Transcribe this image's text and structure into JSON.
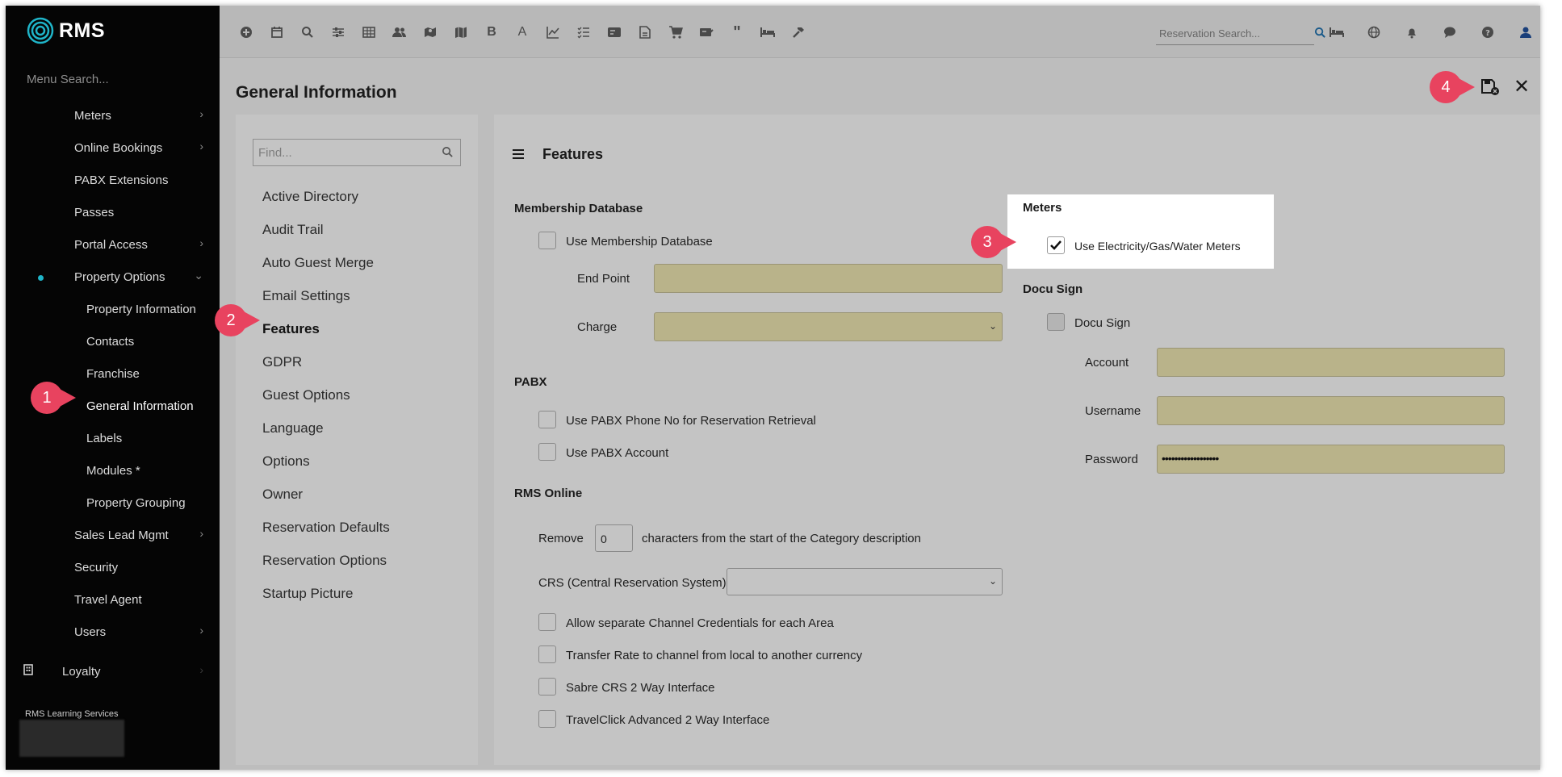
{
  "app": {
    "name": "RMS"
  },
  "sidebar": {
    "search_placeholder": "Menu Search...",
    "items": [
      {
        "label": "Meters",
        "has_chevron": true
      },
      {
        "label": "Online Bookings",
        "has_chevron": true
      },
      {
        "label": "PABX Extensions",
        "has_chevron": false
      },
      {
        "label": "Passes",
        "has_chevron": false
      },
      {
        "label": "Portal Access",
        "has_chevron": true
      },
      {
        "label": "Property Options",
        "has_chevron": true,
        "expanded": true
      },
      {
        "label": "Property Information"
      },
      {
        "label": "Contacts"
      },
      {
        "label": "Franchise"
      },
      {
        "label": "General Information"
      },
      {
        "label": "Labels"
      },
      {
        "label": "Modules *"
      },
      {
        "label": "Property Grouping"
      },
      {
        "label": "Sales Lead Mgmt",
        "has_chevron": true
      },
      {
        "label": "Security"
      },
      {
        "label": "Travel Agent"
      },
      {
        "label": "Users",
        "has_chevron": true
      },
      {
        "label": "Loyalty",
        "has_chevron": true
      }
    ],
    "footer": "RMS Learning Services"
  },
  "toolbar": {
    "icons": [
      "plus-circle-icon",
      "calendar-icon",
      "search-icon",
      "sliders-icon",
      "grid-icon",
      "people-icon",
      "map-pin-icon",
      "map-icon",
      "bold-icon",
      "font-icon",
      "chart-icon",
      "checklist-icon",
      "card-icon",
      "document-icon",
      "cart-icon",
      "ticket-icon",
      "quote-icon",
      "bed-icon",
      "hammer-icon"
    ],
    "reservation_search_placeholder": "Reservation Search...",
    "right_icons": [
      "globe-icon",
      "bell-icon",
      "chat-icon",
      "help-icon",
      "user-icon"
    ]
  },
  "page": {
    "title": "General Information"
  },
  "left_nav": {
    "find_placeholder": "Find...",
    "items": [
      "Active Directory",
      "Audit Trail",
      "Auto Guest Merge",
      "Email Settings",
      "Features",
      "GDPR",
      "Guest Options",
      "Language",
      "Options",
      "Owner",
      "Reservation Defaults",
      "Reservation Options",
      "Startup Picture"
    ],
    "active": "Features"
  },
  "features": {
    "title": "Features",
    "membership": {
      "title": "Membership Database",
      "use_label": "Use Membership Database",
      "end_point_label": "End Point",
      "charge_label": "Charge"
    },
    "pabx": {
      "title": "PABX",
      "phone_label": "Use PABX Phone No for Reservation Retrieval",
      "account_label": "Use PABX Account"
    },
    "rms_online": {
      "title": "RMS Online",
      "remove_label": "Remove",
      "remove_value": "0",
      "remove_suffix": "characters from the start of the Category description",
      "crs_label": "CRS (Central Reservation System)",
      "channel_creds_label": "Allow separate Channel Credentials for each Area",
      "transfer_rate_label": "Transfer Rate to channel from local to another currency",
      "sabre_label": "Sabre CRS 2 Way Interface",
      "travelclick_label": "TravelClick Advanced 2 Way Interface"
    },
    "meters": {
      "title": "Meters",
      "use_label": "Use Electricity/Gas/Water Meters",
      "checked": true
    },
    "docu_sign": {
      "title": "Docu Sign",
      "check_label": "Docu Sign",
      "account_label": "Account",
      "username_label": "Username",
      "password_label": "Password",
      "password_value": "••••••••••••••••••"
    }
  },
  "callouts": [
    "1",
    "2",
    "3",
    "4"
  ],
  "colors": {
    "callout": "#e8435f",
    "sidebar": "#050505",
    "field": "#b9b38a",
    "accent": "#1fb5c9"
  }
}
